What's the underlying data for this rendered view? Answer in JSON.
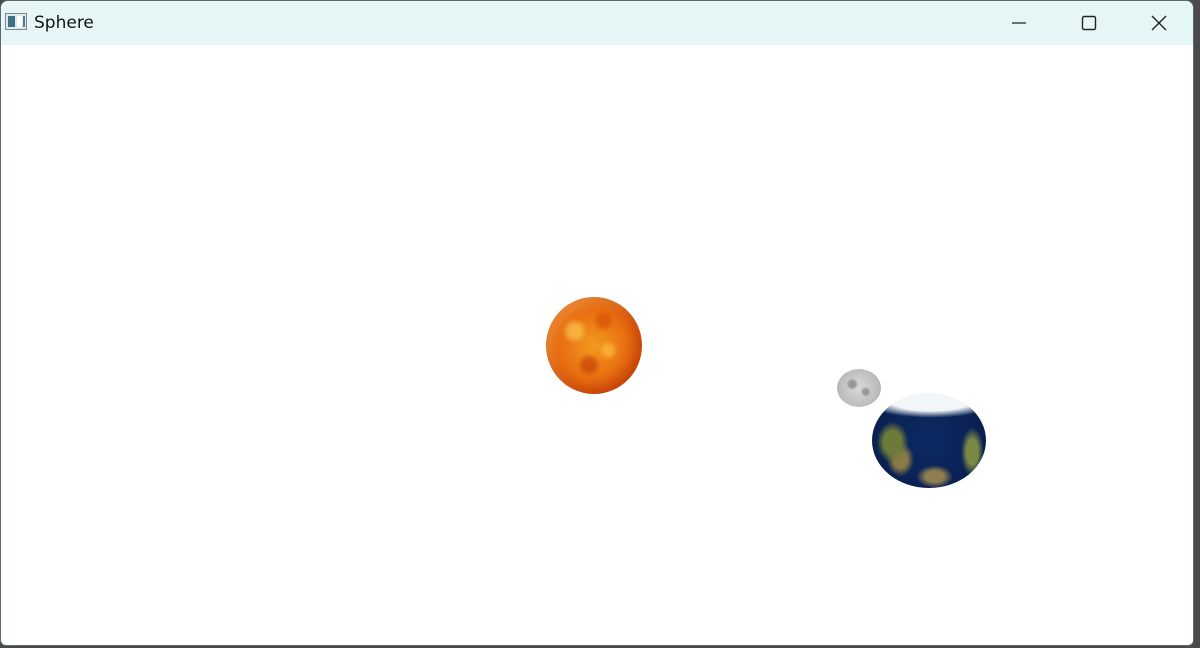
{
  "window": {
    "title": "Sphere"
  },
  "titlebar_buttons": {
    "minimize": "minimize-icon",
    "maximize": "maximize-icon",
    "close": "close-icon"
  },
  "scene": {
    "background": "#ffffff",
    "spheres": [
      {
        "name": "sun",
        "color": "#e7690f"
      },
      {
        "name": "moon",
        "color": "#c4c4c4"
      },
      {
        "name": "earth",
        "color": "#0a2256"
      }
    ]
  },
  "colors": {
    "titlebar": "#e6f6f6",
    "title_text": "#111111"
  }
}
